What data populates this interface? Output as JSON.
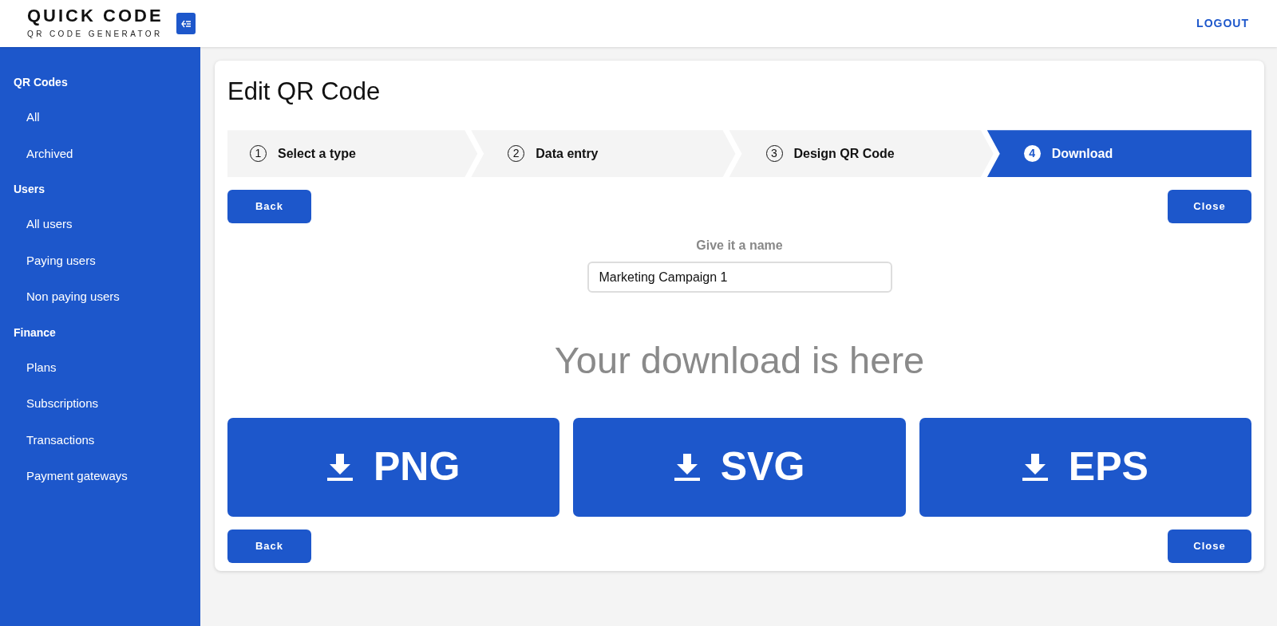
{
  "brand": {
    "title": "QUICK CODE",
    "subtitle": "QR CODE GENERATOR"
  },
  "header": {
    "logout": "LOGOUT"
  },
  "sidebar": {
    "sections": [
      {
        "heading": "QR Codes",
        "items": [
          "All",
          "Archived"
        ]
      },
      {
        "heading": "Users",
        "items": [
          "All users",
          "Paying users",
          "Non paying users"
        ]
      },
      {
        "heading": "Finance",
        "items": [
          "Plans",
          "Subscriptions",
          "Transactions",
          "Payment gateways"
        ]
      }
    ]
  },
  "page": {
    "title": "Edit QR Code",
    "steps": [
      {
        "number": "1",
        "label": "Select a type",
        "selected": false
      },
      {
        "number": "2",
        "label": "Data entry",
        "selected": false
      },
      {
        "number": "3",
        "label": "Design QR Code",
        "selected": false
      },
      {
        "number": "4",
        "label": "Download",
        "selected": true
      }
    ],
    "top_buttons": {
      "back": "Back",
      "close": "Close"
    },
    "name_field": {
      "label": "Give it a name",
      "value": "Marketing Campaign 1"
    },
    "download_heading": "Your download is here",
    "downloads": [
      "PNG",
      "SVG",
      "EPS"
    ],
    "bottom_buttons": {
      "back": "Back",
      "close": "Close"
    }
  }
}
